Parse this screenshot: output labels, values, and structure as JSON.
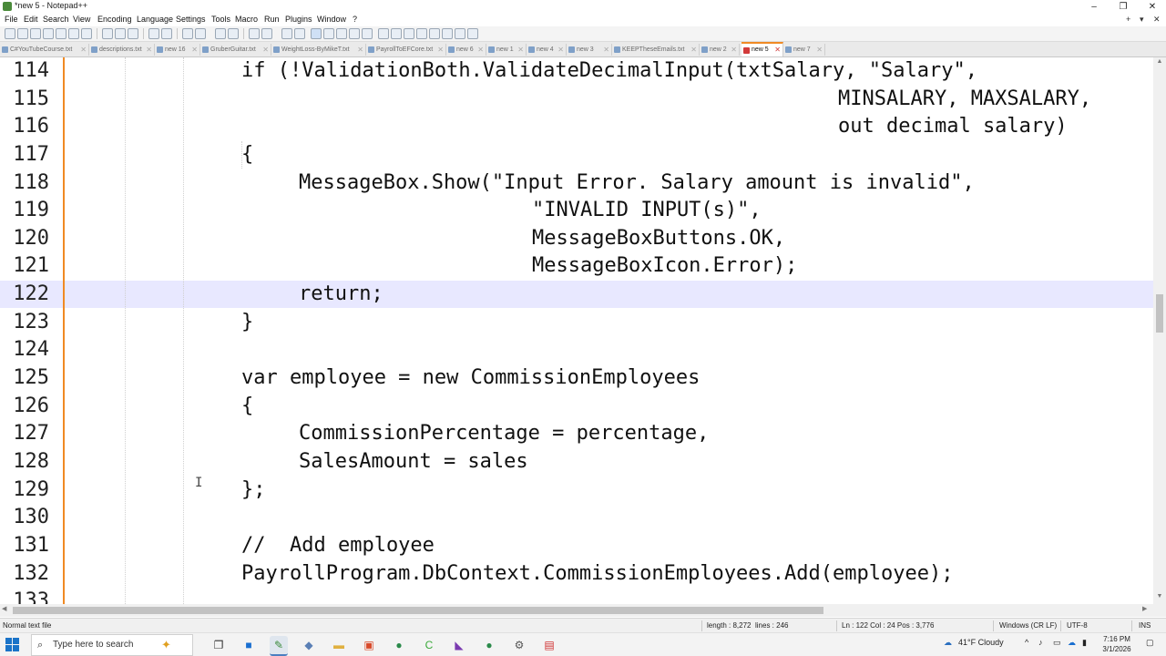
{
  "window": {
    "title": "*new 5 - Notepad++",
    "controls": {
      "minimize": "–",
      "maximize": "❐",
      "close": "✕"
    }
  },
  "menu": {
    "items": [
      "File",
      "Edit",
      "Search",
      "View",
      "Encoding",
      "Language",
      "Settings",
      "Tools",
      "Macro",
      "Run",
      "Plugins",
      "Window",
      "?"
    ],
    "right_controls": [
      "+",
      "▾",
      "✕"
    ]
  },
  "tabs": [
    {
      "label": "C#YouTubeCourse.txt"
    },
    {
      "label": "descriptions.txt"
    },
    {
      "label": "new 16"
    },
    {
      "label": "GruberGuitar.txt"
    },
    {
      "label": "WeightLoss-ByMikeT.txt"
    },
    {
      "label": "PayrollToEFCore.txt"
    },
    {
      "label": "new 6"
    },
    {
      "label": "new 1"
    },
    {
      "label": "new 4"
    },
    {
      "label": "new 3"
    },
    {
      "label": "KEEPTheseEmails.txt"
    },
    {
      "label": "new 2"
    },
    {
      "label": "new 5",
      "active": true
    },
    {
      "label": "new 7"
    }
  ],
  "editor": {
    "current_line": "122",
    "lines": [
      {
        "num": "114",
        "text": "if (!ValidationBoth.ValidateDecimalInput(txtSalary, \"Salary\","
      },
      {
        "num": "115",
        "text": "MINSALARY, MAXSALARY,"
      },
      {
        "num": "116",
        "text": "out decimal salary)"
      },
      {
        "num": "117",
        "text": "{"
      },
      {
        "num": "118",
        "text": "MessageBox.Show(\"Input Error. Salary amount is invalid\","
      },
      {
        "num": "119",
        "text": "\"INVALID INPUT(s)\","
      },
      {
        "num": "120",
        "text": "MessageBoxButtons.OK,"
      },
      {
        "num": "121",
        "text": "MessageBoxIcon.Error);"
      },
      {
        "num": "122",
        "text": "return;"
      },
      {
        "num": "123",
        "text": "}"
      },
      {
        "num": "124",
        "text": ""
      },
      {
        "num": "125",
        "text": "var employee = new CommissionEmployees"
      },
      {
        "num": "126",
        "text": "{"
      },
      {
        "num": "127",
        "text": "CommissionPercentage = percentage,"
      },
      {
        "num": "128",
        "text": "SalesAmount = sales"
      },
      {
        "num": "129",
        "text": "};"
      },
      {
        "num": "130",
        "text": ""
      },
      {
        "num": "131",
        "text": "//  Add employee"
      },
      {
        "num": "132",
        "text": "PayrollProgram.DbContext.CommissionEmployees.Add(employee);"
      },
      {
        "num": "133",
        "text": ""
      }
    ]
  },
  "status": {
    "file_type": "Normal text file",
    "length": "length : 8,272",
    "lines": "lines : 246",
    "position": "Ln : 122    Col : 24    Pos : 3,776",
    "eol": "Windows (CR LF)",
    "encoding": "UTF-8",
    "mode": "INS"
  },
  "taskbar": {
    "search_placeholder": "Type here to search",
    "weather": "41°F  Cloudy",
    "time": "7:16 PM",
    "date": "3/1/2026"
  },
  "colors": {
    "gutter_edge": "#f08a24",
    "current_line": "#e8e8ff",
    "active_tab_accent": "#f08a24"
  }
}
